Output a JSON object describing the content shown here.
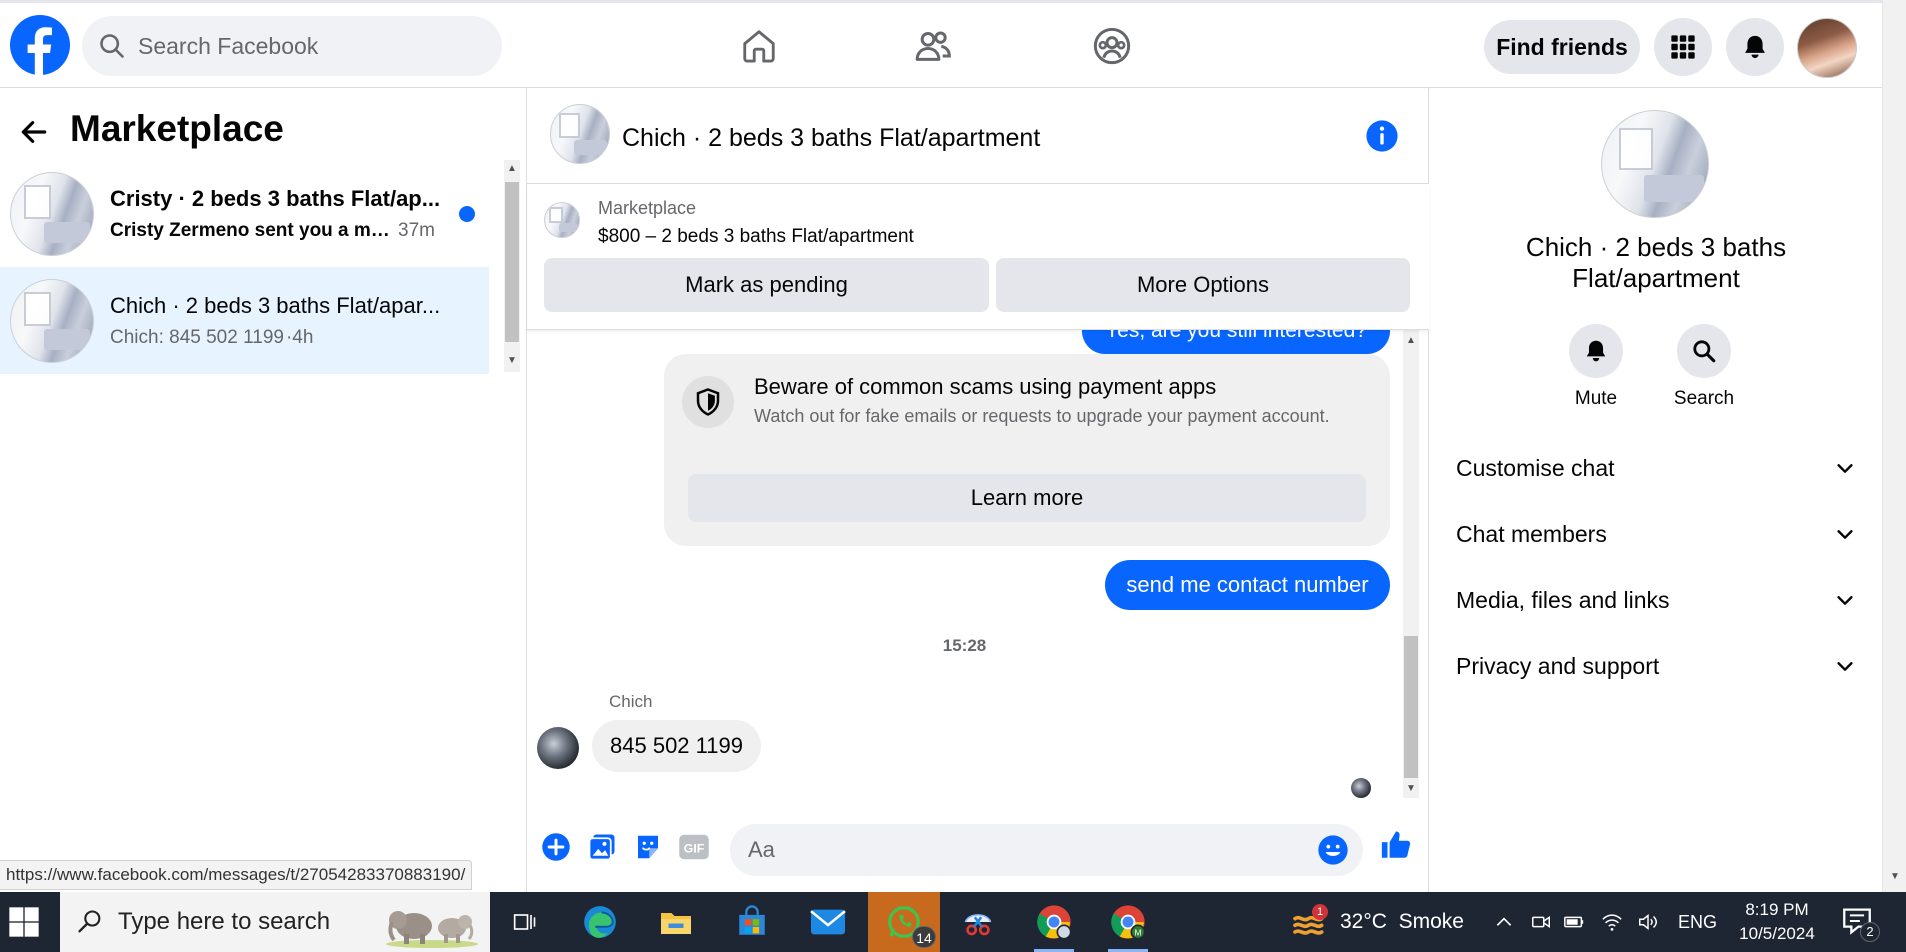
{
  "topnav": {
    "search_placeholder": "Search Facebook",
    "find_friends": "Find friends",
    "brand_color": "#0866ff"
  },
  "left": {
    "title": "Marketplace",
    "conversations": [
      {
        "name": "Cristy · 2 beds 3 baths Flat/ap...",
        "message": "Cristy Zermeno sent you a me...",
        "time": "37m",
        "unread": true
      },
      {
        "name": "Chich · 2 beds 3 baths Flat/apar...",
        "message": "Chich: 845 502 1199",
        "time": "·4h",
        "unread": false,
        "active": true
      }
    ],
    "status_url": "https://www.facebook.com/messages/t/27054283370883190/"
  },
  "chat": {
    "title": "Chich · 2 beds 3 baths Flat/apartment",
    "listing_label": "Marketplace",
    "listing_price": "$800 – 2 beds 3 baths Flat/apartment",
    "mark_pending": "Mark as pending",
    "more_options": "More Options",
    "cut_message": "Yes, are you still interested?",
    "warning": {
      "title": "Beware of common scams using payment apps",
      "body": "Watch out for fake emails or requests to upgrade your payment account.",
      "button": "Learn more"
    },
    "outgoing_message": "send me contact number",
    "timestamp": "15:28",
    "sender": "Chich",
    "incoming_message": "845 502 1199",
    "composer_placeholder": "Aa",
    "gif_label": "GIF"
  },
  "right": {
    "title_line1": "Chich · 2 beds 3 baths",
    "title_line2": "Flat/apartment",
    "mute": "Mute",
    "search": "Search",
    "sections": [
      "Customise chat",
      "Chat members",
      "Media, files and links",
      "Privacy and support"
    ]
  },
  "taskbar": {
    "search_placeholder": "Type here to search",
    "whatsapp_badge": "14",
    "weather_badge": "1",
    "weather": "32°C  Smoke",
    "lang": "ENG",
    "time": "8:19 PM",
    "date": "10/5/2024",
    "notif_count": "2"
  }
}
